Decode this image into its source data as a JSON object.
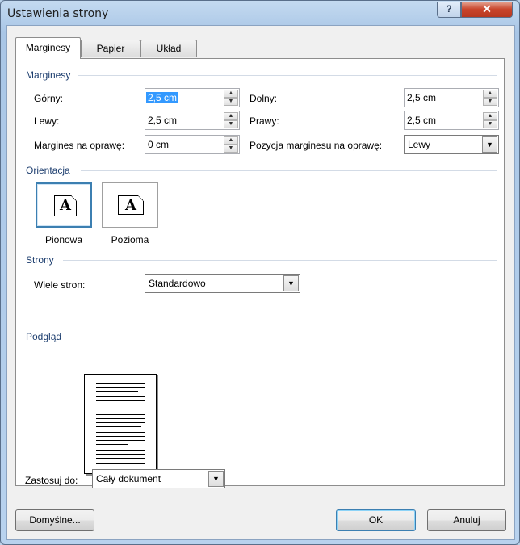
{
  "window": {
    "title": "Ustawienia strony",
    "help_label": "?",
    "close_label": "✕"
  },
  "tabs": [
    {
      "label": "Marginesy",
      "active": true
    },
    {
      "label": "Papier",
      "active": false
    },
    {
      "label": "Układ",
      "active": false
    }
  ],
  "margins": {
    "section_label": "Marginesy",
    "top_label": "Górny:",
    "top_value": "2,5 cm",
    "bottom_label": "Dolny:",
    "bottom_value": "2,5 cm",
    "left_label": "Lewy:",
    "left_value": "2,5 cm",
    "right_label": "Prawy:",
    "right_value": "2,5 cm",
    "gutter_label": "Margines na oprawę:",
    "gutter_value": "0 cm",
    "gutter_pos_label": "Pozycja marginesu na oprawę:",
    "gutter_pos_value": "Lewy"
  },
  "orientation": {
    "section_label": "Orientacja",
    "portrait_label": "Pionowa",
    "landscape_label": "Pozioma",
    "icon_glyph": "A",
    "selected": "portrait"
  },
  "pages": {
    "section_label": "Strony",
    "multiple_label": "Wiele stron:",
    "multiple_value": "Standardowo"
  },
  "preview": {
    "section_label": "Podgląd"
  },
  "apply": {
    "label": "Zastosuj do:",
    "value": "Cały dokument"
  },
  "buttons": {
    "default_label": "Domyślne...",
    "ok_label": "OK",
    "cancel_label": "Anuluj"
  },
  "colors": {
    "accent": "#3399ff",
    "section_text": "#1c3d6e",
    "selected_border": "#3c7fb1"
  }
}
